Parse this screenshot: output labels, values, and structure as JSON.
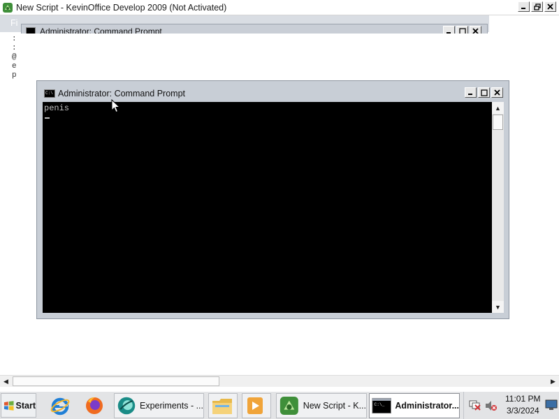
{
  "main_window": {
    "title": "New Script - KevinOffice Develop 2009 (Not Activated)",
    "menu_first": "Fi",
    "gutter_lines": [
      ":",
      ":",
      "@",
      "e",
      "p"
    ],
    "buttons": {
      "minimize": "minimize",
      "maximize": "restore",
      "close": "close"
    }
  },
  "background_cmd": {
    "title": "Administrator:  Command Prompt"
  },
  "cmd_window": {
    "title": "Administrator:  Command Prompt",
    "output": "penis",
    "icon_text": "C:\\"
  },
  "taskbar": {
    "start_label": "Start",
    "quick_launch": [
      "internet-explorer-icon",
      "firefox-icon"
    ],
    "tasks": [
      {
        "label": "Experiments - ...",
        "icon": "experiments-icon",
        "active": false
      },
      {
        "label": "",
        "icon": "file-explorer-icon",
        "active": false
      },
      {
        "label": "",
        "icon": "media-player-icon",
        "active": false
      },
      {
        "label": "New Script - K...",
        "icon": "kevinoffice-icon",
        "active": false
      },
      {
        "label": "Administrator...",
        "icon": "command-prompt-icon",
        "active": true
      }
    ],
    "clock": {
      "time": "11:01 PM",
      "date": "3/3/2024"
    },
    "tray_icons": [
      "network-disconnected-icon",
      "volume-muted-icon",
      "monitor-icon"
    ]
  },
  "colors": {
    "console_bg": "#000000",
    "console_text": "#c0c0c0",
    "window_frame": "#c8ced6",
    "close_red": "#d13438"
  }
}
